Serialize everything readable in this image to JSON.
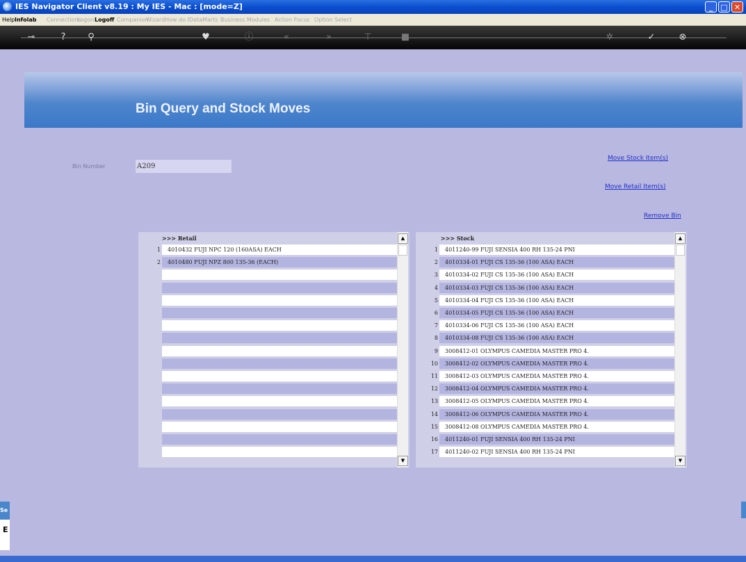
{
  "window": {
    "title": "IES Navigator Client v8.19 : My IES - Mac :       [mode=Z]",
    "min_glyph": "_",
    "max_glyph": "□",
    "close_glyph": "✕"
  },
  "menu": {
    "items": [
      {
        "label": "Help",
        "state": "active"
      },
      {
        "label": "Infolab",
        "state": "bold"
      },
      {
        "label": "Connections",
        "state": "dim"
      },
      {
        "label": "Logon",
        "state": "dim"
      },
      {
        "label": "Logoff",
        "state": "bold"
      },
      {
        "label": "Companion",
        "state": "dim"
      },
      {
        "label": "Wizard",
        "state": "dim"
      },
      {
        "label": "How do I",
        "state": "dim"
      },
      {
        "label": "DataMarts",
        "state": "dim"
      },
      {
        "label": "Business Modules",
        "state": "dim"
      },
      {
        "label": "Action Focus",
        "state": "dim"
      },
      {
        "label": "Option Select",
        "state": "dim"
      }
    ]
  },
  "toolbar": {
    "icons": [
      {
        "name": "key-icon",
        "glyph": "⊸",
        "dim": false
      },
      {
        "name": "help-icon",
        "glyph": "?",
        "dim": false
      },
      {
        "name": "search-icon",
        "glyph": "⚲",
        "dim": false
      },
      {
        "name": "heart-icon",
        "glyph": "♥",
        "dim": false
      },
      {
        "name": "info-icon",
        "glyph": "ⓘ",
        "dim": true
      },
      {
        "name": "rewind-icon",
        "glyph": "«",
        "dim": true
      },
      {
        "name": "forward-icon",
        "glyph": "»",
        "dim": true
      },
      {
        "name": "tree-icon",
        "glyph": "⊤",
        "dim": true
      },
      {
        "name": "stop-icon",
        "glyph": "■",
        "dim": true
      },
      {
        "name": "gear-icon",
        "glyph": "✲",
        "dim": true
      },
      {
        "name": "check-icon",
        "glyph": "✓",
        "dim": false
      },
      {
        "name": "close-icon",
        "glyph": "⊗",
        "dim": false
      }
    ]
  },
  "page": {
    "title": "Bin Query and Stock Moves",
    "bin_label": "Bin Number",
    "bin_value": "A209",
    "links": {
      "move_stock": "Move Stock Item(s)",
      "move_retail": "Move Retail Item(s)",
      "remove_bin": "Remove Bin"
    }
  },
  "retail_list": {
    "header": ">>> Retail",
    "rows": [
      {
        "num": "1",
        "text": "4010432 FUJI NPC 120 (160ASA) EACH"
      },
      {
        "num": "2",
        "text": "4010480 FUJI NPZ 800 135-36 (EACH)"
      },
      {
        "num": "",
        "text": ""
      },
      {
        "num": "",
        "text": ""
      },
      {
        "num": "",
        "text": ""
      },
      {
        "num": "",
        "text": ""
      },
      {
        "num": "",
        "text": ""
      },
      {
        "num": "",
        "text": ""
      },
      {
        "num": "",
        "text": ""
      },
      {
        "num": "",
        "text": ""
      },
      {
        "num": "",
        "text": ""
      },
      {
        "num": "",
        "text": ""
      },
      {
        "num": "",
        "text": ""
      },
      {
        "num": "",
        "text": ""
      },
      {
        "num": "",
        "text": ""
      },
      {
        "num": "",
        "text": ""
      },
      {
        "num": "",
        "text": ""
      }
    ]
  },
  "stock_list": {
    "header": ">>> Stock",
    "rows": [
      {
        "num": "1",
        "text": "4011240-99 FUJI SENSIA 400 RH 135-24 PNI"
      },
      {
        "num": "2",
        "text": "4010334-01 FUJI CS 135-36 (100 ASA) EACH"
      },
      {
        "num": "3",
        "text": "4010334-02 FUJI CS 135-36 (100 ASA) EACH"
      },
      {
        "num": "4",
        "text": "4010334-03 FUJI CS 135-36 (100 ASA) EACH"
      },
      {
        "num": "5",
        "text": "4010334-04 FUJI CS 135-36 (100 ASA) EACH"
      },
      {
        "num": "6",
        "text": "4010334-05 FUJI CS 135-36 (100 ASA) EACH"
      },
      {
        "num": "7",
        "text": "4010334-06 FUJI CS 135-36 (100 ASA) EACH"
      },
      {
        "num": "8",
        "text": "4010334-08 FUJI CS 135-36 (100 ASA) EACH"
      },
      {
        "num": "9",
        "text": "3008412-01 OLYMPUS CAMEDIA MASTER PRO 4."
      },
      {
        "num": "10",
        "text": "3008412-02 OLYMPUS CAMEDIA MASTER PRO 4."
      },
      {
        "num": "11",
        "text": "3008412-03 OLYMPUS CAMEDIA MASTER PRO 4."
      },
      {
        "num": "12",
        "text": "3008412-04 OLYMPUS CAMEDIA MASTER PRO 4."
      },
      {
        "num": "13",
        "text": "3008412-05 OLYMPUS CAMEDIA MASTER PRO 4."
      },
      {
        "num": "14",
        "text": "3008412-06 OLYMPUS CAMEDIA MASTER PRO 4."
      },
      {
        "num": "15",
        "text": "3008412-08 OLYMPUS CAMEDIA MASTER PRO 4."
      },
      {
        "num": "16",
        "text": "4011240-01 FUJI SENSIA 400 RH 135-24 PNI"
      },
      {
        "num": "17",
        "text": "4011240-02 FUJI SENSIA 400 RH 135-24 PNI"
      }
    ]
  },
  "scroll": {
    "up": "▲",
    "down": "▼"
  },
  "side": {
    "tab_label": "Se",
    "letter": "E"
  }
}
